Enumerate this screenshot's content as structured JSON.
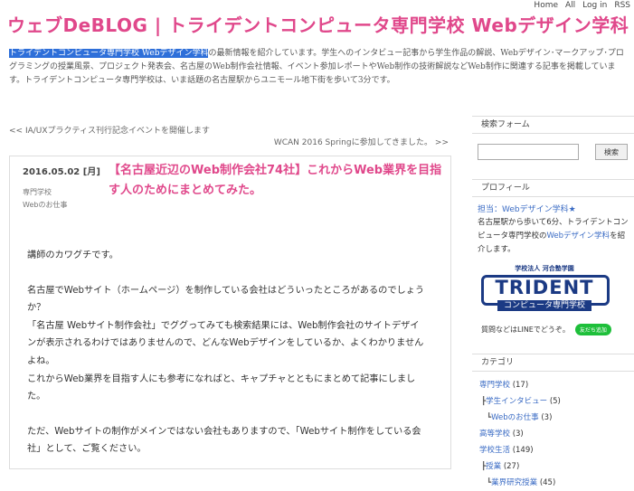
{
  "topnav": {
    "home": "Home",
    "all": "All",
    "login": "Log in",
    "rss": "RSS"
  },
  "site": {
    "title": "ウェブDeBLOG | トライデントコンピュータ専門学校 Webデザイン学科",
    "desc_highlight": "トライデントコンピュータ専門学校 Webデザイン学科",
    "desc_rest": "の最新情報を紹介しています。学生へのインタビュー記事から学生作品の解説、Webデザイン･マークアップ･プログラミングの授業風景、プロジェクト発表会、名古屋のWeb制作会社情報、イベント参加レポートやWeb制作の技術解説などWeb制作に関連する記事を掲載しています。トライデントコンピュータ専門学校は、いま話題の名古屋駅からユニモール地下街を歩いて3分です。"
  },
  "nav": {
    "prev": "<< IA/UXプラクティス刊行記念イベントを開催します",
    "next": "WCAN 2016 Springに参加してきました。 >>"
  },
  "post": {
    "date": "2016.05.02 [月]",
    "categories": [
      "専門学校",
      "Webのお仕事"
    ],
    "title": "【名古屋近辺のWeb制作会社74社】これからWeb業界を目指す人のためにまとめてみた。",
    "paragraphs": [
      "講師のカワグチです。",
      "",
      "名古屋でWebサイト（ホームページ）を制作している会社はどういったところがあるのでしょうか？",
      "「名古屋 Webサイト制作会社」でググってみても検索結果には、Web制作会社のサイトデザインが表示されるわけではありませんので、どんなWebデザインをしているか、よくわかりませんよね。",
      "これからWeb業界を目指す人にも参考になればと、キャプチャとともにまとめて記事にしました。",
      "",
      "ただ、Webサイトの制作がメインではない会社もありますので、「Webサイト制作をしている会社」として、ご覧ください。"
    ]
  },
  "sidebar": {
    "search_heading": "検索フォーム",
    "search_placeholder": "",
    "search_button": "検索",
    "profile_heading": "プロフィール",
    "profile_name": "担当：Webデザイン学科★",
    "profile_text_1": "名古屋駅から歩いて6分、トライデントコンピュータ専門学校の",
    "profile_text_strong": "Webデザイン学科",
    "profile_text_2": "を紹介します。",
    "logo_sub": "学校法人 河合塾学園",
    "logo_main": "TRIDENT",
    "logo_bar": "コンピュータ専門学校",
    "line_text": "質問などはLINEでどうぞ。",
    "line_button": "友だち追加",
    "category_heading": "カテゴリ",
    "categories": [
      {
        "prefix": "",
        "name": "専門学校",
        "count": "(17)",
        "level": "top"
      },
      {
        "prefix": "┣",
        "name": "学生インタビュー",
        "count": "(5)",
        "level": "sub"
      },
      {
        "prefix": "┗",
        "name": "Webのお仕事",
        "count": "(3)",
        "level": "subsub"
      },
      {
        "prefix": "",
        "name": "高等学校",
        "count": "(3)",
        "level": "top"
      },
      {
        "prefix": "",
        "name": "学校生活",
        "count": "(149)",
        "level": "top"
      },
      {
        "prefix": "┣",
        "name": "授業",
        "count": "(27)",
        "level": "sub"
      },
      {
        "prefix": "┗",
        "name": "業界研究授業",
        "count": "(45)",
        "level": "subsub"
      }
    ]
  }
}
